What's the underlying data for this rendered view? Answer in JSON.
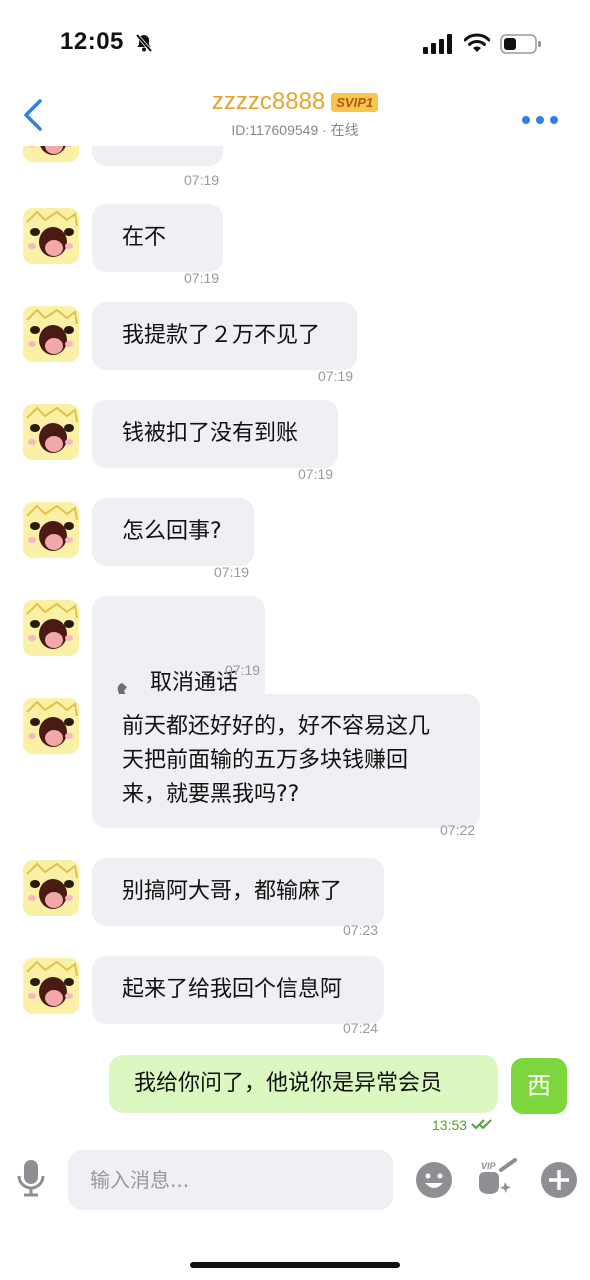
{
  "status_bar": {
    "time": "12:05"
  },
  "header": {
    "title": "zzzzc8888",
    "badge": "SVIP1",
    "subtitle": "ID:117609549 · 在线",
    "title_color": "#e6a52a"
  },
  "messages": [
    {
      "text": "",
      "time": "07:19"
    },
    {
      "text": "在不",
      "time": "07:19"
    },
    {
      "text": "我提款了２万不见了",
      "time": "07:19"
    },
    {
      "text": "钱被扣了没有到账",
      "time": "07:19"
    },
    {
      "text": "怎么回事?",
      "time": "07:19"
    },
    {
      "text": "取消通话",
      "time": "07:19",
      "icon": "phone-icon"
    },
    {
      "text": "前天都还好好的，好不容易这几\n天把前面输的五万多块钱赚回\n来，就要黑我吗??",
      "time": "07:22"
    },
    {
      "text": "别搞阿大哥，都输麻了",
      "time": "07:23"
    },
    {
      "text": "起来了给我回个信息阿",
      "time": "07:24"
    }
  ],
  "outgoing": {
    "text": "我给你问了，他说你是异常会员",
    "time": "13:53",
    "avatar_char": "西",
    "bubble_color": "#dcf8c0",
    "avatar_color": "#7ed63f"
  },
  "input": {
    "placeholder": "输入消息..."
  },
  "colors": {
    "incoming_bubble": "#efeff4",
    "accent": "#2f7fe8"
  }
}
